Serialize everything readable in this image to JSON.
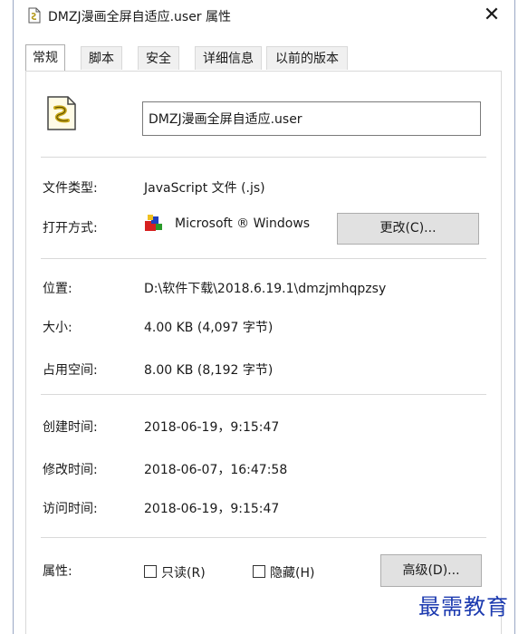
{
  "window": {
    "title": "DMZJ漫画全屏自适应.user 属性",
    "close_glyph": "✕"
  },
  "tabs": [
    {
      "label": "常规",
      "active": true
    },
    {
      "label": "脚本",
      "active": false
    },
    {
      "label": "安全",
      "active": false
    },
    {
      "label": "详细信息",
      "active": false
    },
    {
      "label": "以前的版本",
      "active": false
    }
  ],
  "general": {
    "file_name": "DMZJ漫画全屏自适应.user",
    "file_type_label": "文件类型:",
    "file_type_value": "JavaScript 文件 (.js)",
    "open_with_label": "打开方式:",
    "open_with_value": "Microsoft ® Windows",
    "change_button": "更改(C)...",
    "location_label": "位置:",
    "location_value": "D:\\软件下载\\2018.6.19.1\\dmzjmhqpzsy",
    "size_label": "大小:",
    "size_value": "4.00 KB (4,097 字节)",
    "size_on_disk_label": "占用空间:",
    "size_on_disk_value": "8.00 KB (8,192 字节)",
    "created_label": "创建时间:",
    "created_value": "2018-06-19，9:15:47",
    "modified_label": "修改时间:",
    "modified_value": "2018-06-07，16:47:58",
    "accessed_label": "访问时间:",
    "accessed_value": "2018-06-19，9:15:47",
    "attributes_label": "属性:",
    "readonly_label": "只读(R)",
    "readonly_checked": false,
    "hidden_label": "隐藏(H)",
    "hidden_checked": false,
    "advanced_button": "高级(D)..."
  },
  "watermark": "最需教育",
  "icons": {
    "file": "javascript-file-icon",
    "app": "windows-script-host-icon"
  },
  "colors": {
    "watermark": "#1d3bb0",
    "button_bg": "#e1e1e1",
    "tab_bg": "#f0f0f0"
  }
}
